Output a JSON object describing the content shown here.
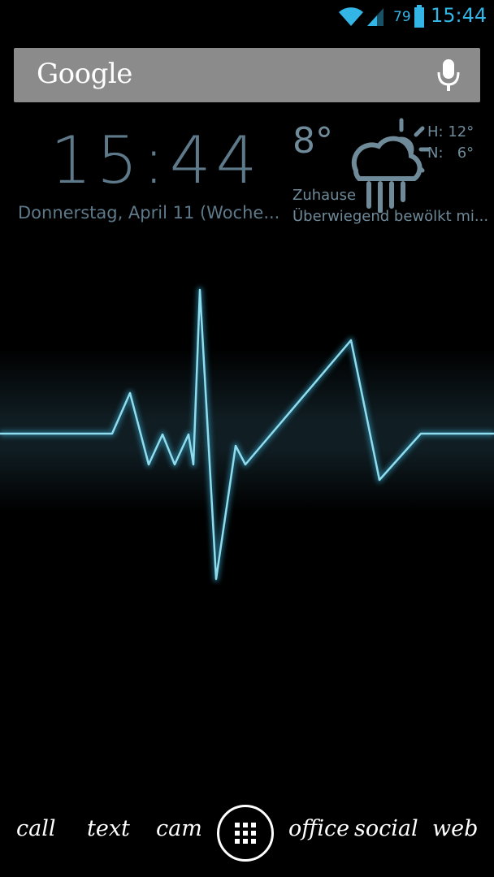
{
  "status_bar": {
    "battery_percent": "79",
    "time": "15:44",
    "icons": [
      "wifi-icon",
      "signal-icon",
      "battery-icon"
    ],
    "accent_color": "#33b5e5"
  },
  "search": {
    "logo": "Google",
    "mic_icon": "mic-icon",
    "bar_color": "#8b8b8b"
  },
  "clock": {
    "time": "15:44",
    "date": "Donnerstag, April 11 (Woche..."
  },
  "weather": {
    "temperature": "8°",
    "high": "H: 12°",
    "low": "N:   6°",
    "location": "Zuhause",
    "condition": "Überwiegend bewölkt mi...",
    "icon": "cloud-sun-rain-icon",
    "color": "#6f8a99"
  },
  "wallpaper": {
    "type": "heartbeat-ecg-line",
    "line_color": "#7fd4ea"
  },
  "dock": {
    "items": [
      {
        "label": "call"
      },
      {
        "label": "text"
      },
      {
        "label": "cam"
      },
      {
        "label": "office"
      },
      {
        "label": "social"
      },
      {
        "label": "web"
      }
    ],
    "app_drawer_icon": "grid-icon"
  }
}
